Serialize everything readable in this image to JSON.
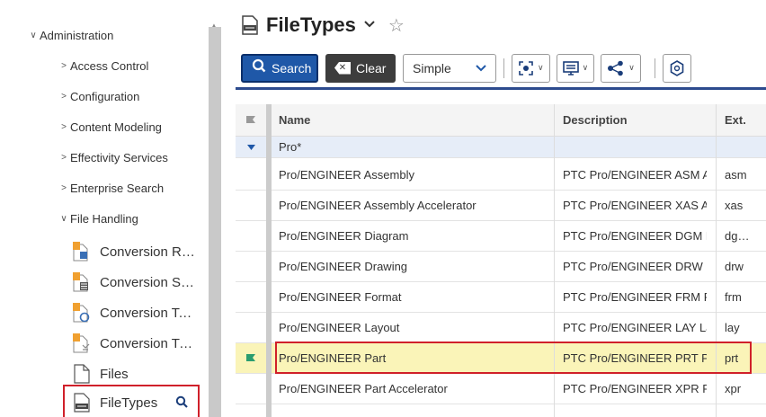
{
  "sidebar": {
    "root": {
      "label": "Administration",
      "expanded": true
    },
    "sections": [
      {
        "label": "Access Control",
        "expanded": false
      },
      {
        "label": "Configuration",
        "expanded": false
      },
      {
        "label": "Content Modeling",
        "expanded": false
      },
      {
        "label": "Effectivity Services",
        "expanded": false
      },
      {
        "label": "Enterprise Search",
        "expanded": false
      },
      {
        "label": "File Handling",
        "expanded": true
      }
    ],
    "leaves": [
      {
        "label": "Conversion Ru…",
        "icon": "conversion-rules-icon"
      },
      {
        "label": "Conversion Se…",
        "icon": "conversion-settings-icon"
      },
      {
        "label": "Conversion Ta…",
        "icon": "conversion-tasks-icon"
      },
      {
        "label": "Conversion Ty…",
        "icon": "conversion-types-icon"
      },
      {
        "label": "Files",
        "icon": "file-icon"
      }
    ],
    "selected": {
      "label": "FileTypes",
      "icon": "filetype-icon"
    }
  },
  "header": {
    "title": "FileTypes"
  },
  "toolbar": {
    "search_label": "Search",
    "clear_label": "Clear",
    "mode_value": "Simple",
    "tools": [
      "focus-icon",
      "display-icon",
      "share-icon",
      "settings-icon"
    ]
  },
  "table": {
    "columns": [
      "Name",
      "Description",
      "Ext."
    ],
    "filter": {
      "name": "Pro*"
    },
    "rows": [
      {
        "name": "Pro/ENGINEER Assembly",
        "description": "PTC Pro/ENGINEER ASM A…",
        "ext": "asm"
      },
      {
        "name": "Pro/ENGINEER Assembly Accelerator",
        "description": "PTC Pro/ENGINEER XAS A…",
        "ext": "xas"
      },
      {
        "name": "Pro/ENGINEER Diagram",
        "description": "PTC Pro/ENGINEER DGM D…",
        "ext": "dg…"
      },
      {
        "name": "Pro/ENGINEER Drawing",
        "description": "PTC Pro/ENGINEER DRW D…",
        "ext": "drw"
      },
      {
        "name": "Pro/ENGINEER Format",
        "description": "PTC Pro/ENGINEER FRM F…",
        "ext": "frm"
      },
      {
        "name": "Pro/ENGINEER Layout",
        "description": "PTC Pro/ENGINEER LAY La…",
        "ext": "lay"
      },
      {
        "name": "Pro/ENGINEER Part",
        "description": "PTC Pro/ENGINEER PRT P…",
        "ext": "prt",
        "selected": true
      },
      {
        "name": "Pro/ENGINEER Part Accelerator",
        "description": "PTC Pro/ENGINEER XPR P…",
        "ext": "xpr"
      }
    ]
  },
  "colors": {
    "primary": "#1f58a8",
    "accent_border": "#2d4b8e",
    "highlight_outline": "#d0202a",
    "selected_row": "#faf4b8",
    "filter_row": "#e6edf8",
    "flag": "#2a9d6f"
  }
}
